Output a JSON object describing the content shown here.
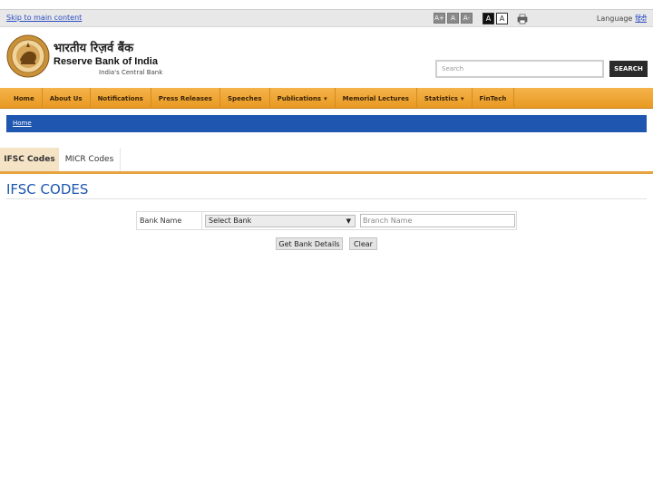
{
  "topbar": {
    "skip_link": "Skip to main content",
    "font_buttons": [
      "A+",
      "A",
      "A-"
    ],
    "contrast_buttons": [
      "A",
      "A"
    ],
    "language_label": "Language",
    "language_option": "हिंदी"
  },
  "header": {
    "name_hindi": "भारतीय रिज़र्व बैंक",
    "name_english": "Reserve Bank of India",
    "tagline": "India's Central Bank",
    "search_placeholder": "Search",
    "search_button": "SEARCH"
  },
  "nav": {
    "items": [
      {
        "label": "Home"
      },
      {
        "label": "About Us"
      },
      {
        "label": "Notifications"
      },
      {
        "label": "Press Releases"
      },
      {
        "label": "Speeches"
      },
      {
        "label": "Publications",
        "dropdown": "▾"
      },
      {
        "label": "Memorial Lectures"
      },
      {
        "label": "Statistics",
        "dropdown": "▾"
      },
      {
        "label": "FinTech"
      }
    ]
  },
  "breadcrumb": {
    "home": "Home"
  },
  "tabs": {
    "active": "IFSC Codes",
    "inactive": "MICR Codes"
  },
  "main": {
    "title": "IFSC CODES",
    "bank_label": "Bank Name",
    "bank_select_value": "Select Bank",
    "bank_select_arrow": "▼",
    "branch_placeholder": "Branch Name",
    "get_details_button": "Get Bank Details",
    "clear_button": "Clear"
  },
  "colors": {
    "nav_orange": "#e89a22",
    "breadcrumb_blue": "#1e56b0",
    "title_blue": "#1e56b0",
    "tab_active_bg": "#f5e3c6"
  }
}
